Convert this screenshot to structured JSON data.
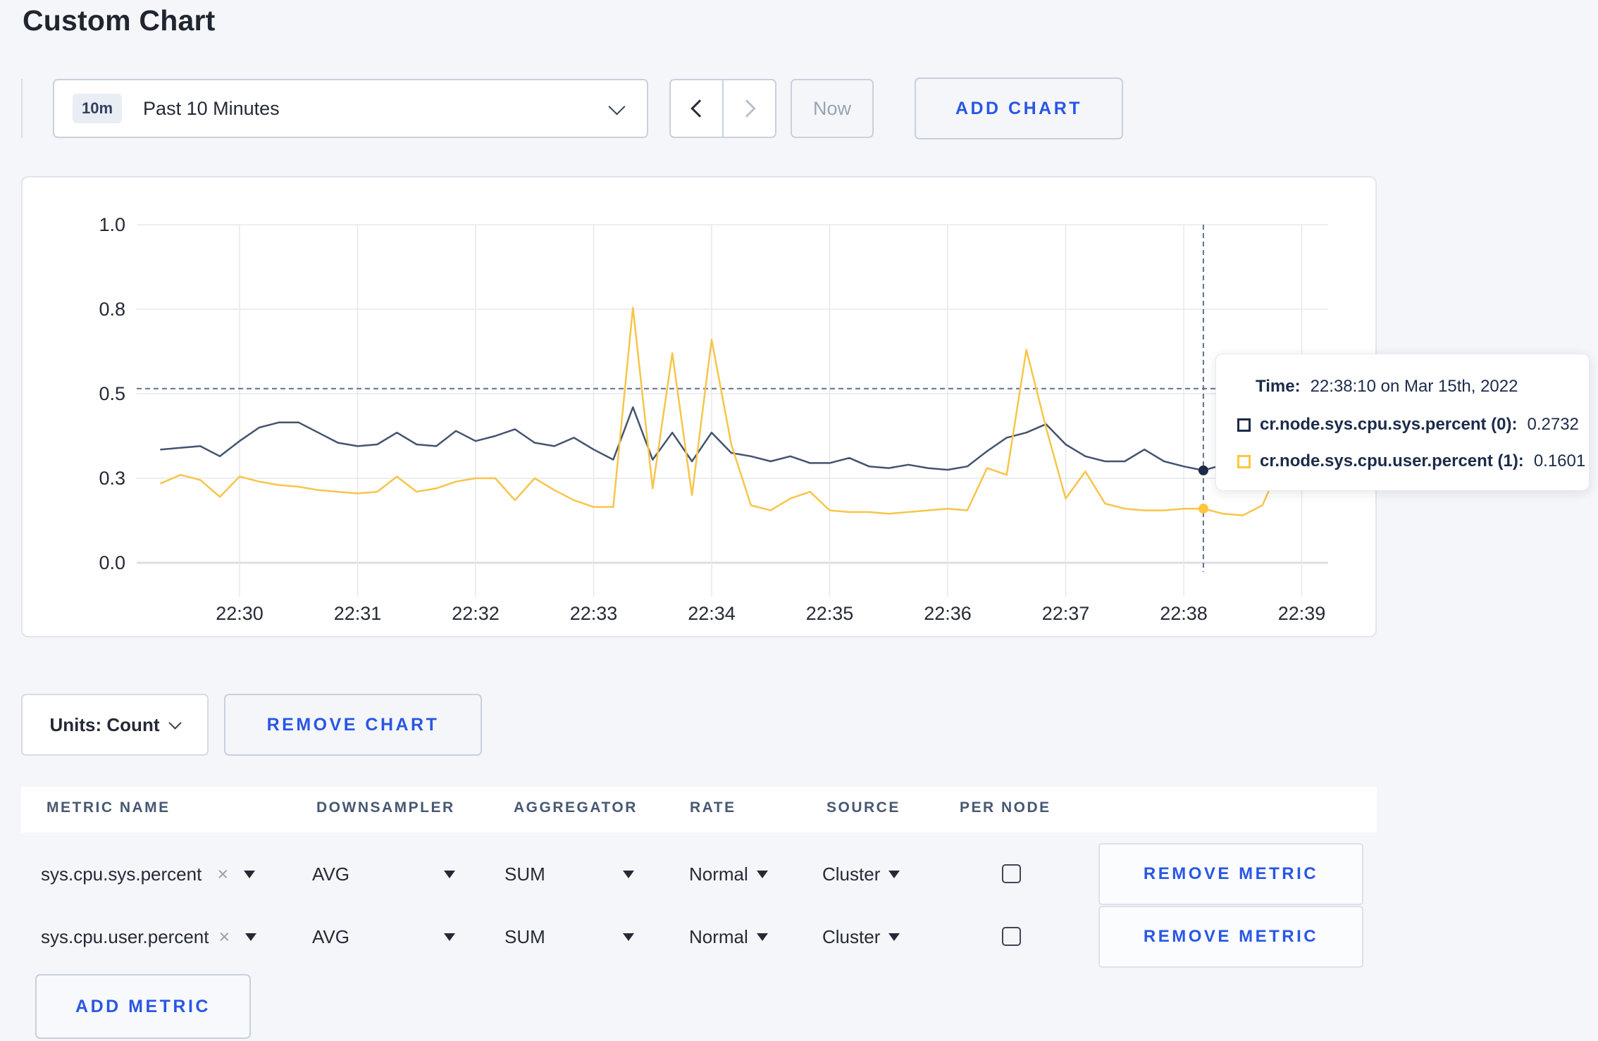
{
  "page_title": "Custom Chart",
  "toolbar": {
    "range_badge": "10m",
    "range_label": "Past 10 Minutes",
    "now_label": "Now",
    "add_chart_label": "ADD CHART"
  },
  "chart_data": {
    "type": "line",
    "title": "",
    "xlabel": "",
    "ylabel": "",
    "ylim": [
      0,
      1
    ],
    "grid": true,
    "legend_position": "none",
    "y_tick_values": [
      0,
      0.25,
      0.5,
      0.75,
      1.0
    ],
    "y_tick_labels": [
      "0.0",
      "0.3",
      "0.5",
      "0.8",
      "1.0"
    ],
    "x_ticks": [
      "22:30",
      "22:31",
      "22:32",
      "22:33",
      "22:34",
      "22:35",
      "22:36",
      "22:37",
      "22:38",
      "22:39"
    ],
    "x_start_min": -0.66667,
    "x_step_min": 0.16667,
    "series": [
      {
        "name": "cr.node.sys.cpu.sys.percent",
        "color": "#44536E",
        "values": [
          0.335,
          0.34,
          0.345,
          0.315,
          0.36,
          0.4,
          0.415,
          0.415,
          0.385,
          0.355,
          0.345,
          0.35,
          0.385,
          0.35,
          0.345,
          0.39,
          0.36,
          0.375,
          0.395,
          0.355,
          0.345,
          0.37,
          0.335,
          0.305,
          0.46,
          0.305,
          0.385,
          0.3,
          0.385,
          0.325,
          0.315,
          0.3,
          0.315,
          0.295,
          0.295,
          0.31,
          0.285,
          0.28,
          0.29,
          0.28,
          0.275,
          0.285,
          0.33,
          0.37,
          0.385,
          0.41,
          0.35,
          0.315,
          0.3,
          0.3,
          0.335,
          0.3,
          0.285,
          0.2732,
          0.29,
          0.3,
          0.295,
          0.3,
          0.295
        ]
      },
      {
        "name": "cr.node.sys.cpu.user.percent",
        "color": "#F7C549",
        "values": [
          0.235,
          0.26,
          0.245,
          0.195,
          0.255,
          0.24,
          0.23,
          0.225,
          0.215,
          0.21,
          0.205,
          0.21,
          0.255,
          0.21,
          0.22,
          0.24,
          0.25,
          0.25,
          0.185,
          0.25,
          0.215,
          0.185,
          0.165,
          0.165,
          0.755,
          0.22,
          0.62,
          0.2,
          0.66,
          0.35,
          0.17,
          0.155,
          0.19,
          0.21,
          0.155,
          0.15,
          0.15,
          0.145,
          0.15,
          0.155,
          0.16,
          0.155,
          0.28,
          0.26,
          0.63,
          0.4,
          0.19,
          0.27,
          0.175,
          0.16,
          0.155,
          0.155,
          0.16,
          0.1601,
          0.145,
          0.14,
          0.17,
          0.3,
          0.235
        ]
      }
    ],
    "crosshair": {
      "x_min": 8.16667,
      "y_value": 0.515,
      "point_index": 53
    }
  },
  "tooltip": {
    "time_label": "Time:",
    "time_value": "22:38:10 on Mar 15th, 2022",
    "rows": [
      {
        "label": "cr.node.sys.cpu.sys.percent (0):",
        "value": "0.2732",
        "swatch": "#1C2B4A"
      },
      {
        "label": "cr.node.sys.cpu.user.percent (1):",
        "value": "0.1601",
        "swatch": "#FFC53D"
      }
    ]
  },
  "chart_footer": {
    "units_label": "Units: Count",
    "remove_chart_label": "REMOVE CHART"
  },
  "metrics_table": {
    "headers": [
      "METRIC NAME",
      "DOWNSAMPLER",
      "AGGREGATOR",
      "RATE",
      "SOURCE",
      "PER NODE"
    ],
    "rows": [
      {
        "name": "sys.cpu.sys.percent",
        "downsampler": "AVG",
        "aggregator": "SUM",
        "rate": "Normal",
        "source": "Cluster",
        "per_node_checked": false,
        "remove_label": "REMOVE METRIC"
      },
      {
        "name": "sys.cpu.user.percent",
        "downsampler": "AVG",
        "aggregator": "SUM",
        "rate": "Normal",
        "source": "Cluster",
        "per_node_checked": false,
        "remove_label": "REMOVE METRIC"
      }
    ],
    "add_metric_label": "ADD METRIC"
  },
  "colors": {
    "accent_blue": "#2957E4",
    "page_background": "#F5F6FA",
    "gridline": "#E7E8EA",
    "crosshair": "#5C7193",
    "header_text": "#475872"
  }
}
